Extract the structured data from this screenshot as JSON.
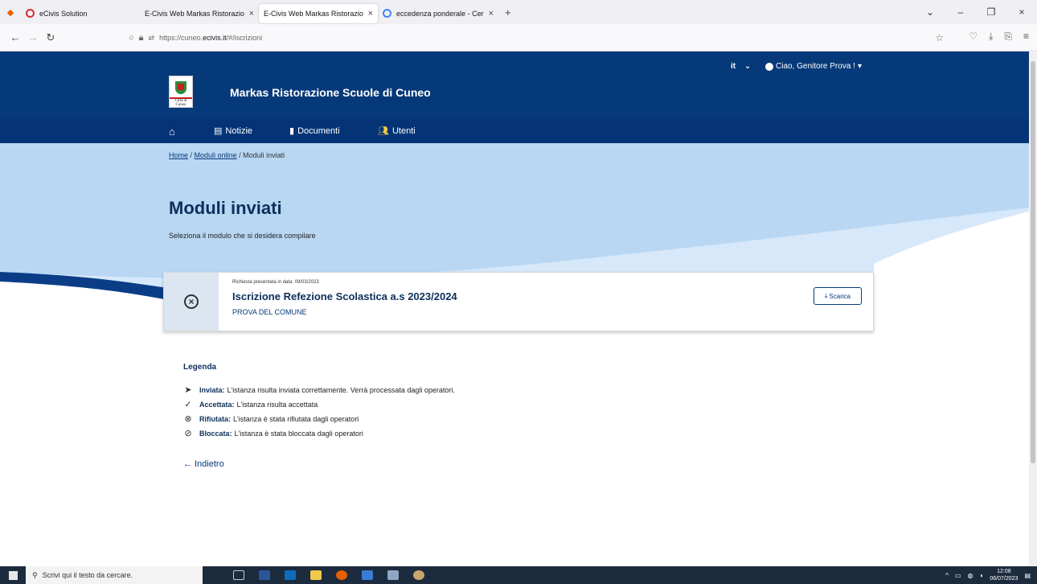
{
  "browser": {
    "tabs": [
      {
        "label": "eCivis Solution",
        "active": false
      },
      {
        "label": "E-Civis Web Markas Ristorazione Sc",
        "active": false
      },
      {
        "label": "E-Civis Web Markas Ristorazione Sc",
        "active": true
      },
      {
        "label": "eccedenza ponderale - Cerca co",
        "active": false
      }
    ],
    "new_tab": "+",
    "url_prefix": "https://cuneo.",
    "url_domain": "ecivis.it",
    "url_path": "/#/iscrizioni"
  },
  "header": {
    "logo_caption": "Città di Cuneo",
    "site_title": "Markas Ristorazione Scuole di Cuneo",
    "lang": "it",
    "user_menu": "Ciao, Genitore Prova !"
  },
  "menu": {
    "notizie": "Notizie",
    "documenti": "Documenti",
    "utenti": "Utenti"
  },
  "breadcrumb": {
    "home": "Home",
    "moduli_online": "Moduli online",
    "current": "Moduli inviati"
  },
  "page": {
    "title": "Moduli inviati",
    "subtitle": "Seleziona il modulo che si desidera compilare"
  },
  "card": {
    "date": "Richiesta presentata in data: 09/03/2023",
    "title": "Iscrizione Refezione Scolastica a.s 2023/2024",
    "name": "PROVA DEL COMUNE",
    "download": "Scarica"
  },
  "legend": {
    "title": "Legenda",
    "items": [
      {
        "key": "Inviata:",
        "text": "L'istanza risulta inviata correttamente. Verrà processata dagli operatori."
      },
      {
        "key": "Accettata:",
        "text": "L'istanza risulta accettata"
      },
      {
        "key": "Rifiutata:",
        "text": "L'istanza è stata rifiutata dagli operatori"
      },
      {
        "key": "Bloccata:",
        "text": "L'istanza è stata bloccata dagli operatori"
      }
    ]
  },
  "back": "Indietro",
  "taskbar": {
    "search_placeholder": "Scrivi qui il testo da cercare.",
    "time": "12:08",
    "date": "06/07/2023"
  },
  "colors": {
    "header": "#06397a",
    "hero": "#b9d7f3",
    "accent": "#0d2f5b"
  }
}
